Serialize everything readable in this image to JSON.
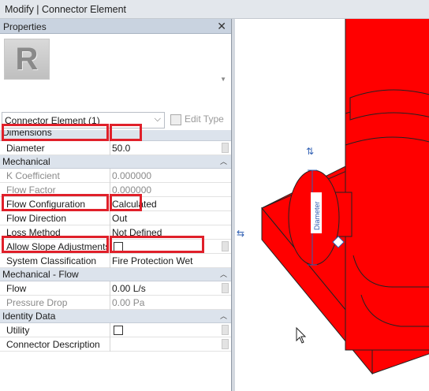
{
  "window": {
    "title": "Modify | Connector Element"
  },
  "properties_panel": {
    "header": "Properties",
    "close_glyph": "✕",
    "type_icon_letter": "R",
    "type_selector": "Connector Element (1)",
    "edit_type_label": "Edit Type",
    "groups": {
      "dimensions": "Dimensions",
      "mechanical": "Mechanical",
      "mechanical_flow": "Mechanical - Flow",
      "identity_data": "Identity Data"
    },
    "rows": {
      "diameter": {
        "name": "Diameter",
        "value": "50.0"
      },
      "k_coefficient": {
        "name": "K Coefficient",
        "value": "0.000000"
      },
      "flow_factor": {
        "name": "Flow Factor",
        "value": "0.000000"
      },
      "flow_configuration": {
        "name": "Flow Configuration",
        "value": "Calculated"
      },
      "flow_direction": {
        "name": "Flow Direction",
        "value": "Out"
      },
      "loss_method": {
        "name": "Loss Method",
        "value": "Not Defined"
      },
      "allow_slope": {
        "name": "Allow Slope Adjustments",
        "checked": false
      },
      "system_classification": {
        "name": "System Classification",
        "value": "Fire Protection Wet"
      },
      "flow": {
        "name": "Flow",
        "value": "0.00 L/s"
      },
      "pressure_drop": {
        "name": "Pressure Drop",
        "value": "0.00 Pa"
      },
      "utility": {
        "name": "Utility",
        "checked": false
      },
      "connector_description": {
        "name": "Connector Description",
        "value": ""
      }
    },
    "highlight_color": "#e0202a"
  },
  "viewport": {
    "model_color": "#ff0000",
    "dimension_label": "Diameter",
    "dimension_color": "#2f5fb3"
  }
}
